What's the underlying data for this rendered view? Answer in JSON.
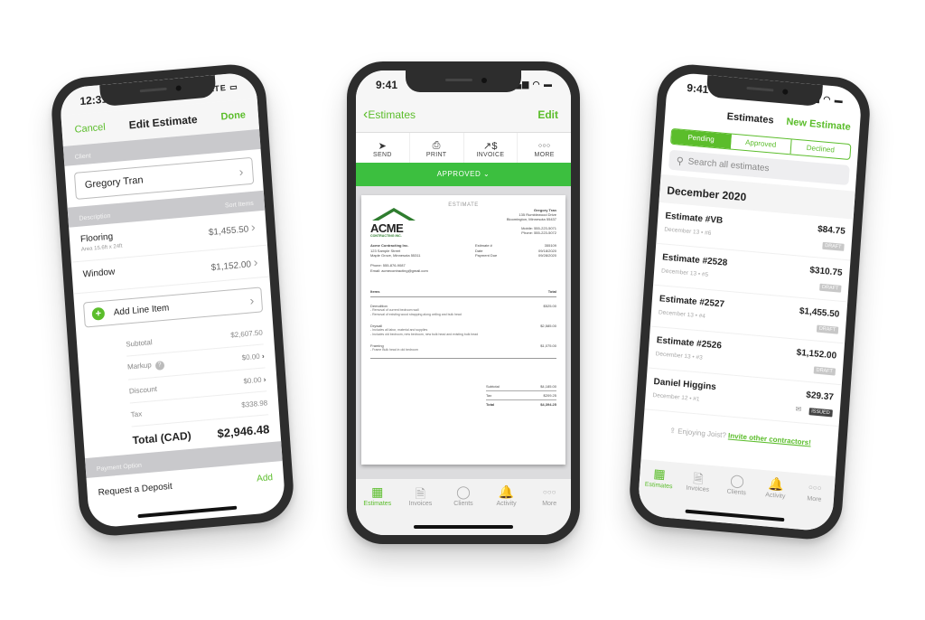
{
  "colors": {
    "accent": "#5bbd2b",
    "approved_bar": "#3cbf3f",
    "frame": "#2d2d2d",
    "section_gray": "#c9c9cc"
  },
  "left_phone": {
    "status": {
      "time": "12:31",
      "signal": "LTE"
    },
    "nav": {
      "cancel": "Cancel",
      "title": "Edit Estimate",
      "done": "Done"
    },
    "client_section": "Client",
    "client_name": "Gregory Tran",
    "description_section": "Description",
    "sort_items": "Sort Items",
    "line_items": [
      {
        "name": "Flooring",
        "detail": "Area 15.6ft x 24ft",
        "amount": "$1,455.50"
      },
      {
        "name": "Window",
        "detail": "",
        "amount": "$1,152.00"
      }
    ],
    "add_line_item": "Add Line Item",
    "summary": {
      "subtotal_label": "Subtotal",
      "subtotal": "$2,607.50",
      "markup_label": "Markup",
      "markup": "$0.00",
      "discount_label": "Discount",
      "discount": "$0.00",
      "tax_label": "Tax",
      "tax": "$338.98",
      "total_label": "Total (CAD)",
      "total": "$2,946.48"
    },
    "payment_section": "Payment Option",
    "deposit_label": "Request a Deposit",
    "deposit_add": "Add"
  },
  "middle_phone": {
    "status": {
      "time": "9:41"
    },
    "nav": {
      "back": "Estimates",
      "edit": "Edit"
    },
    "actions": [
      {
        "icon": "send-icon",
        "glyph": "➤",
        "label": "SEND"
      },
      {
        "icon": "print-icon",
        "glyph": "⎙",
        "label": "PRINT"
      },
      {
        "icon": "invoice-icon",
        "glyph": "↗$",
        "label": "INVOICE"
      },
      {
        "icon": "more-icon",
        "glyph": "○○○",
        "label": "MORE"
      }
    ],
    "status_bar": "APPROVED",
    "document": {
      "title": "ESTIMATE",
      "company_logo": {
        "name": "ACME",
        "sub": "CONTRACTING INC."
      },
      "client": {
        "name": "Gregory Tran",
        "address1": "135 Rumblewood Drive",
        "address2": "Bloomington, Minnesota 55437",
        "mobile": "Mobile: 555-223-5071",
        "phone": "Phone: 555-223-5072"
      },
      "company": {
        "name": "Acme Contracting Inc.",
        "address1": "123 Sample Street",
        "address2": "Maple Grove, Minnesota 55311",
        "phone": "Phone: 555-876-9087",
        "email": "Email: acmecontracting@gmail.com"
      },
      "meta": [
        {
          "label": "Estimate #",
          "value": "355109"
        },
        {
          "label": "Date",
          "value": "09/18/2020"
        },
        {
          "label": "Payment Due",
          "value": "09/28/2020"
        }
      ],
      "items_header": {
        "items": "Items",
        "total": "Total"
      },
      "items": [
        {
          "name": "Demolition",
          "lines": [
            "- Removal of current bedroom wall",
            "- Removal of existing wood strapping along ceiling and bulk head"
          ],
          "total": "$525.00"
        },
        {
          "name": "Drywall",
          "lines": [
            "- Includes all labor, material and supplies",
            "- Includes old bedroom, new bedroom, new bulk head and existing bulk head"
          ],
          "total": "$2,585.00"
        },
        {
          "name": "Framing",
          "lines": [
            "- Frame Bulk head in old bedroom"
          ],
          "total": "$1,075.00"
        }
      ],
      "totals": [
        {
          "label": "Subtotal",
          "value": "$4,185.00"
        },
        {
          "label": "Tax",
          "value": "$209.25"
        },
        {
          "label": "Total",
          "value": "$4,394.25"
        }
      ]
    },
    "tabs": [
      {
        "icon": "estimates-icon",
        "glyph": "▦",
        "label": "Estimates",
        "active": true
      },
      {
        "icon": "invoices-icon",
        "glyph": "🗎",
        "label": "Invoices"
      },
      {
        "icon": "clients-icon",
        "glyph": "◯",
        "label": "Clients"
      },
      {
        "icon": "activity-icon",
        "glyph": "🔔",
        "label": "Activity"
      },
      {
        "icon": "more-icon",
        "glyph": "○○○",
        "label": "More"
      }
    ]
  },
  "right_phone": {
    "status": {
      "time": "9:41"
    },
    "nav": {
      "title": "Estimates",
      "new_estimate": "New Estimate"
    },
    "segments": [
      "Pending",
      "Approved",
      "Declined"
    ],
    "active_segment": "Pending",
    "search_placeholder": "Search all estimates",
    "month": "December 2020",
    "estimates": [
      {
        "name": "Estimate #VB",
        "date": "December 13 • #6",
        "amount": "$84.75",
        "status": "DRAFT"
      },
      {
        "name": "Estimate #2528",
        "date": "December 13 • #5",
        "amount": "$310.75",
        "status": "DRAFT"
      },
      {
        "name": "Estimate #2527",
        "date": "December 13 • #4",
        "amount": "$1,455.50",
        "status": "DRAFT"
      },
      {
        "name": "Estimate #2526",
        "date": "December 13 • #3",
        "amount": "$1,152.00",
        "status": "DRAFT"
      },
      {
        "name": "Daniel Higgins",
        "date": "December 12 • #1",
        "amount": "$29.37",
        "status": "ISSUED"
      }
    ],
    "invite_prefix": "Enjoying Joist?",
    "invite_link": "Invite other contractors!",
    "tabs": [
      {
        "label": "Estimates"
      },
      {
        "label": "Invoices"
      },
      {
        "label": "Clients"
      },
      {
        "label": "Activity"
      },
      {
        "label": "More"
      }
    ]
  }
}
